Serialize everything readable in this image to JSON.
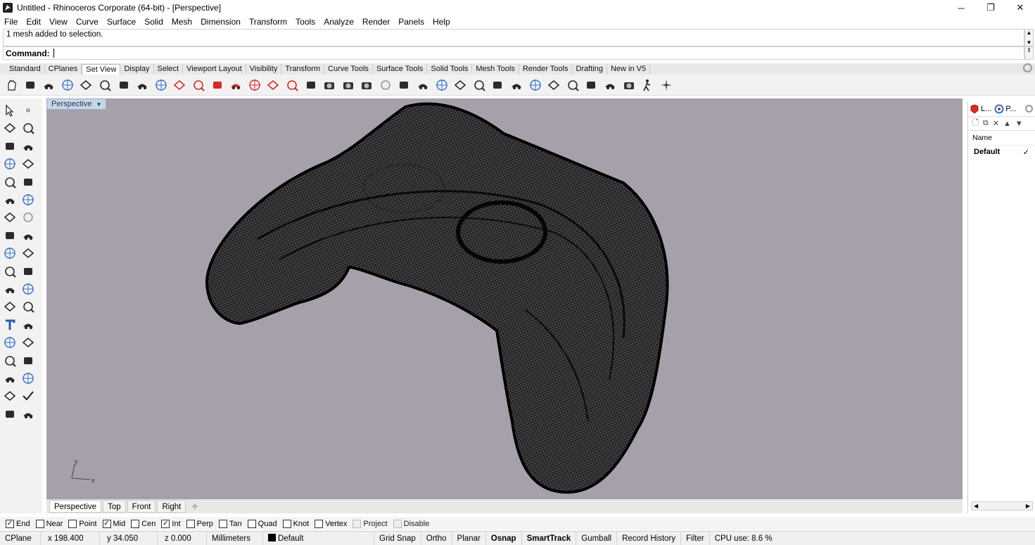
{
  "window": {
    "title": "Untitled - Rhinoceros Corporate (64-bit) - [Perspective]",
    "controls": [
      "─",
      "❐",
      "✕"
    ]
  },
  "menu": [
    "File",
    "Edit",
    "View",
    "Curve",
    "Surface",
    "Solid",
    "Mesh",
    "Dimension",
    "Transform",
    "Tools",
    "Analyze",
    "Render",
    "Panels",
    "Help"
  ],
  "history": {
    "text": "1 mesh added to selection."
  },
  "command": {
    "label": "Command:",
    "value": ""
  },
  "toolbar_tabs": {
    "items": [
      "Standard",
      "CPlanes",
      "Set View",
      "Display",
      "Select",
      "Viewport Layout",
      "Visibility",
      "Transform",
      "Curve Tools",
      "Surface Tools",
      "Solid Tools",
      "Mesh Tools",
      "Render Tools",
      "Drafting",
      "New in V5"
    ],
    "active": "Set View"
  },
  "toolbar_icons": [
    "pan-icon",
    "rotate-view-icon",
    "zoom-dynamic-icon",
    "zoom-extents-icon",
    "zoom-window-icon",
    "zoom-selected-icon",
    "undo-view-icon",
    "zoom-out-icon",
    "zoom-1to1-icon",
    "front-view-icon",
    "back-view-icon",
    "top-car-icon",
    "left-car-icon",
    "right-car-icon",
    "bottom-car-icon",
    "perspective-car-icon",
    "named-view-icon",
    "camera-icon",
    "place-camera-icon",
    "set-camera-icon",
    "sphere-icon",
    "target-icon",
    "crosshair-icon",
    "target-point-icon",
    "lens-icon",
    "plan-view-icon",
    "perspective-view-icon",
    "elevation-icon",
    "twin-elevation-icon",
    "tilt-icon",
    "tilt2-icon",
    "tilt-horizontal-icon",
    "tilt-horizontal2-icon",
    "rotate-camera-icon",
    "walk-icon",
    "star-sparkle-icon"
  ],
  "left_tools": [
    "select-arrow-icon",
    "point-icon",
    "polyline-icon",
    "control-curve-icon",
    "circle-icon",
    "ellipse-icon",
    "arc-icon",
    "rectangle-icon",
    "polygon-icon",
    "fillet-curve-icon",
    "surface-point-icon",
    "extrude-icon",
    "box-solid-icon",
    "sphere-solid-icon",
    "cylinder-icon",
    "plane-surface-icon",
    "mesh-gear-icon",
    "analyze-icon",
    "transform-icon",
    "dimension-icon",
    "blob-icon",
    "blobs-icon",
    "curve-tool-icon",
    "curve-tool2-icon",
    "text-icon",
    "scale-icon",
    "array-icon",
    "mirror-icon",
    "box-edit-icon",
    "explode-icon",
    "grid-array-icon",
    "display-icon",
    "pencil-icon",
    "check-icon",
    "group-icon",
    "layer-icon"
  ],
  "viewport": {
    "label": "Perspective",
    "axis_x": "x",
    "axis_y": "y"
  },
  "viewport_tabs": [
    "Perspective",
    "Top",
    "Front",
    "Right"
  ],
  "layers_panel": {
    "tabs": [
      "L...",
      "P..."
    ],
    "column": "Name",
    "rows": [
      {
        "name": "Default",
        "current": "✓"
      }
    ]
  },
  "osnap": [
    {
      "label": "End",
      "checked": true
    },
    {
      "label": "Near",
      "checked": false
    },
    {
      "label": "Point",
      "checked": false
    },
    {
      "label": "Mid",
      "checked": true
    },
    {
      "label": "Cen",
      "checked": false
    },
    {
      "label": "Int",
      "checked": true
    },
    {
      "label": "Perp",
      "checked": false
    },
    {
      "label": "Tan",
      "checked": false
    },
    {
      "label": "Quad",
      "checked": false
    },
    {
      "label": "Knot",
      "checked": false
    },
    {
      "label": "Vertex",
      "checked": false
    },
    {
      "label": "Project",
      "checked": false,
      "disabled": true
    },
    {
      "label": "Disable",
      "checked": false,
      "disabled": true
    }
  ],
  "status": {
    "cplane": "CPlane",
    "x": "x 198.400",
    "y": "y 34.050",
    "z": "z 0.000",
    "units": "Millimeters",
    "layer": "Default",
    "grid_snap": "Grid Snap",
    "ortho": "Ortho",
    "planar": "Planar",
    "osnap": "Osnap",
    "smarttrack": "SmartTrack",
    "gumball": "Gumball",
    "record_history": "Record History",
    "filter": "Filter",
    "cpu": "CPU use: 8.6 %"
  }
}
